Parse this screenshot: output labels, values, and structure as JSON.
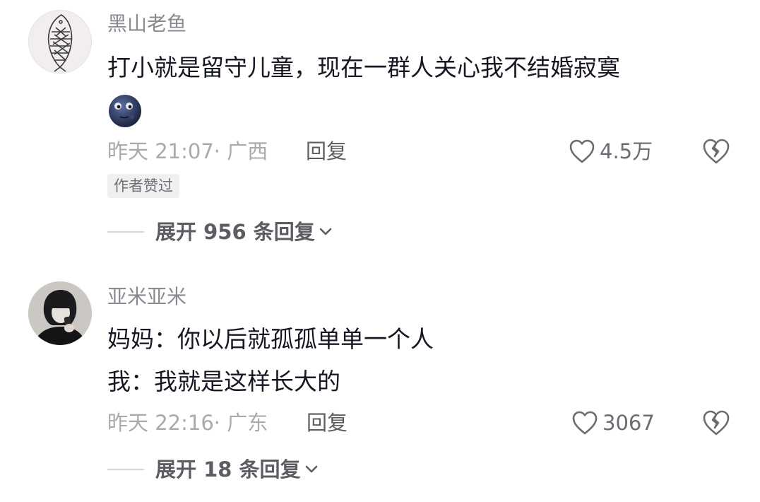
{
  "comments": [
    {
      "username": "黑山老鱼",
      "lines": [
        "打小就是留守儿童，现在一群人关心我不结婚寂寞"
      ],
      "emoji": "moon-face-emoji",
      "time_location": "昨天 21:07· 广西",
      "reply_label": "回复",
      "likes": "4.5万",
      "badge": "作者赞过",
      "expand_label": "展开 956 条回复"
    },
    {
      "username": "亚米亚米",
      "lines": [
        "妈妈：你以后就孤孤单单一个人",
        "我：我就是这样长大的"
      ],
      "time_location": "昨天 22:16· 广东",
      "reply_label": "回复",
      "likes": "3067",
      "expand_label": "展开 18 条回复"
    }
  ],
  "colors": {
    "text_primary": "#161823",
    "text_meta": "#a9aaae",
    "text_secondary": "#5c5d63",
    "background": "#ffffff"
  }
}
